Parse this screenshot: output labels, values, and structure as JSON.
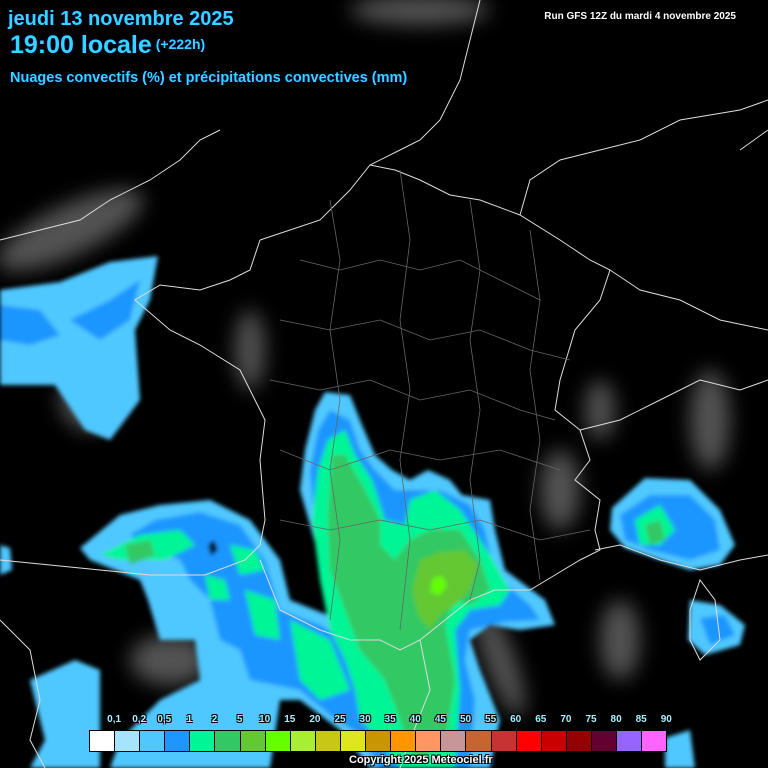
{
  "header": {
    "date": "jeudi 13 novembre 2025",
    "time": "19:00 locale",
    "lead": "(+222h)",
    "subtitle": "Nuages convectifs (%) et précipitations convectives (mm)",
    "run": "Run GFS 12Z du mardi 4 novembre 2025"
  },
  "legend": {
    "labels": [
      "0,1",
      "0,2",
      "0,5",
      "1",
      "2",
      "5",
      "10",
      "15",
      "20",
      "25",
      "30",
      "35",
      "40",
      "45",
      "50",
      "55",
      "60",
      "65",
      "70",
      "75",
      "80",
      "85",
      "90"
    ],
    "colors": [
      "#ffffff",
      "#a5e3ff",
      "#50c8ff",
      "#1e96ff",
      "#00f596",
      "#32c864",
      "#64c832",
      "#64ff00",
      "#a8ee32",
      "#c8c814",
      "#dde61e",
      "#c89600",
      "#ff9600",
      "#ff9664",
      "#c89696",
      "#c86432",
      "#c83232",
      "#ff0000",
      "#c80000",
      "#960000",
      "#640032",
      "#9664ff",
      "#ff64ff"
    ]
  },
  "footer": {
    "copyright": "Copyright 2025 Meteociel.fr"
  }
}
